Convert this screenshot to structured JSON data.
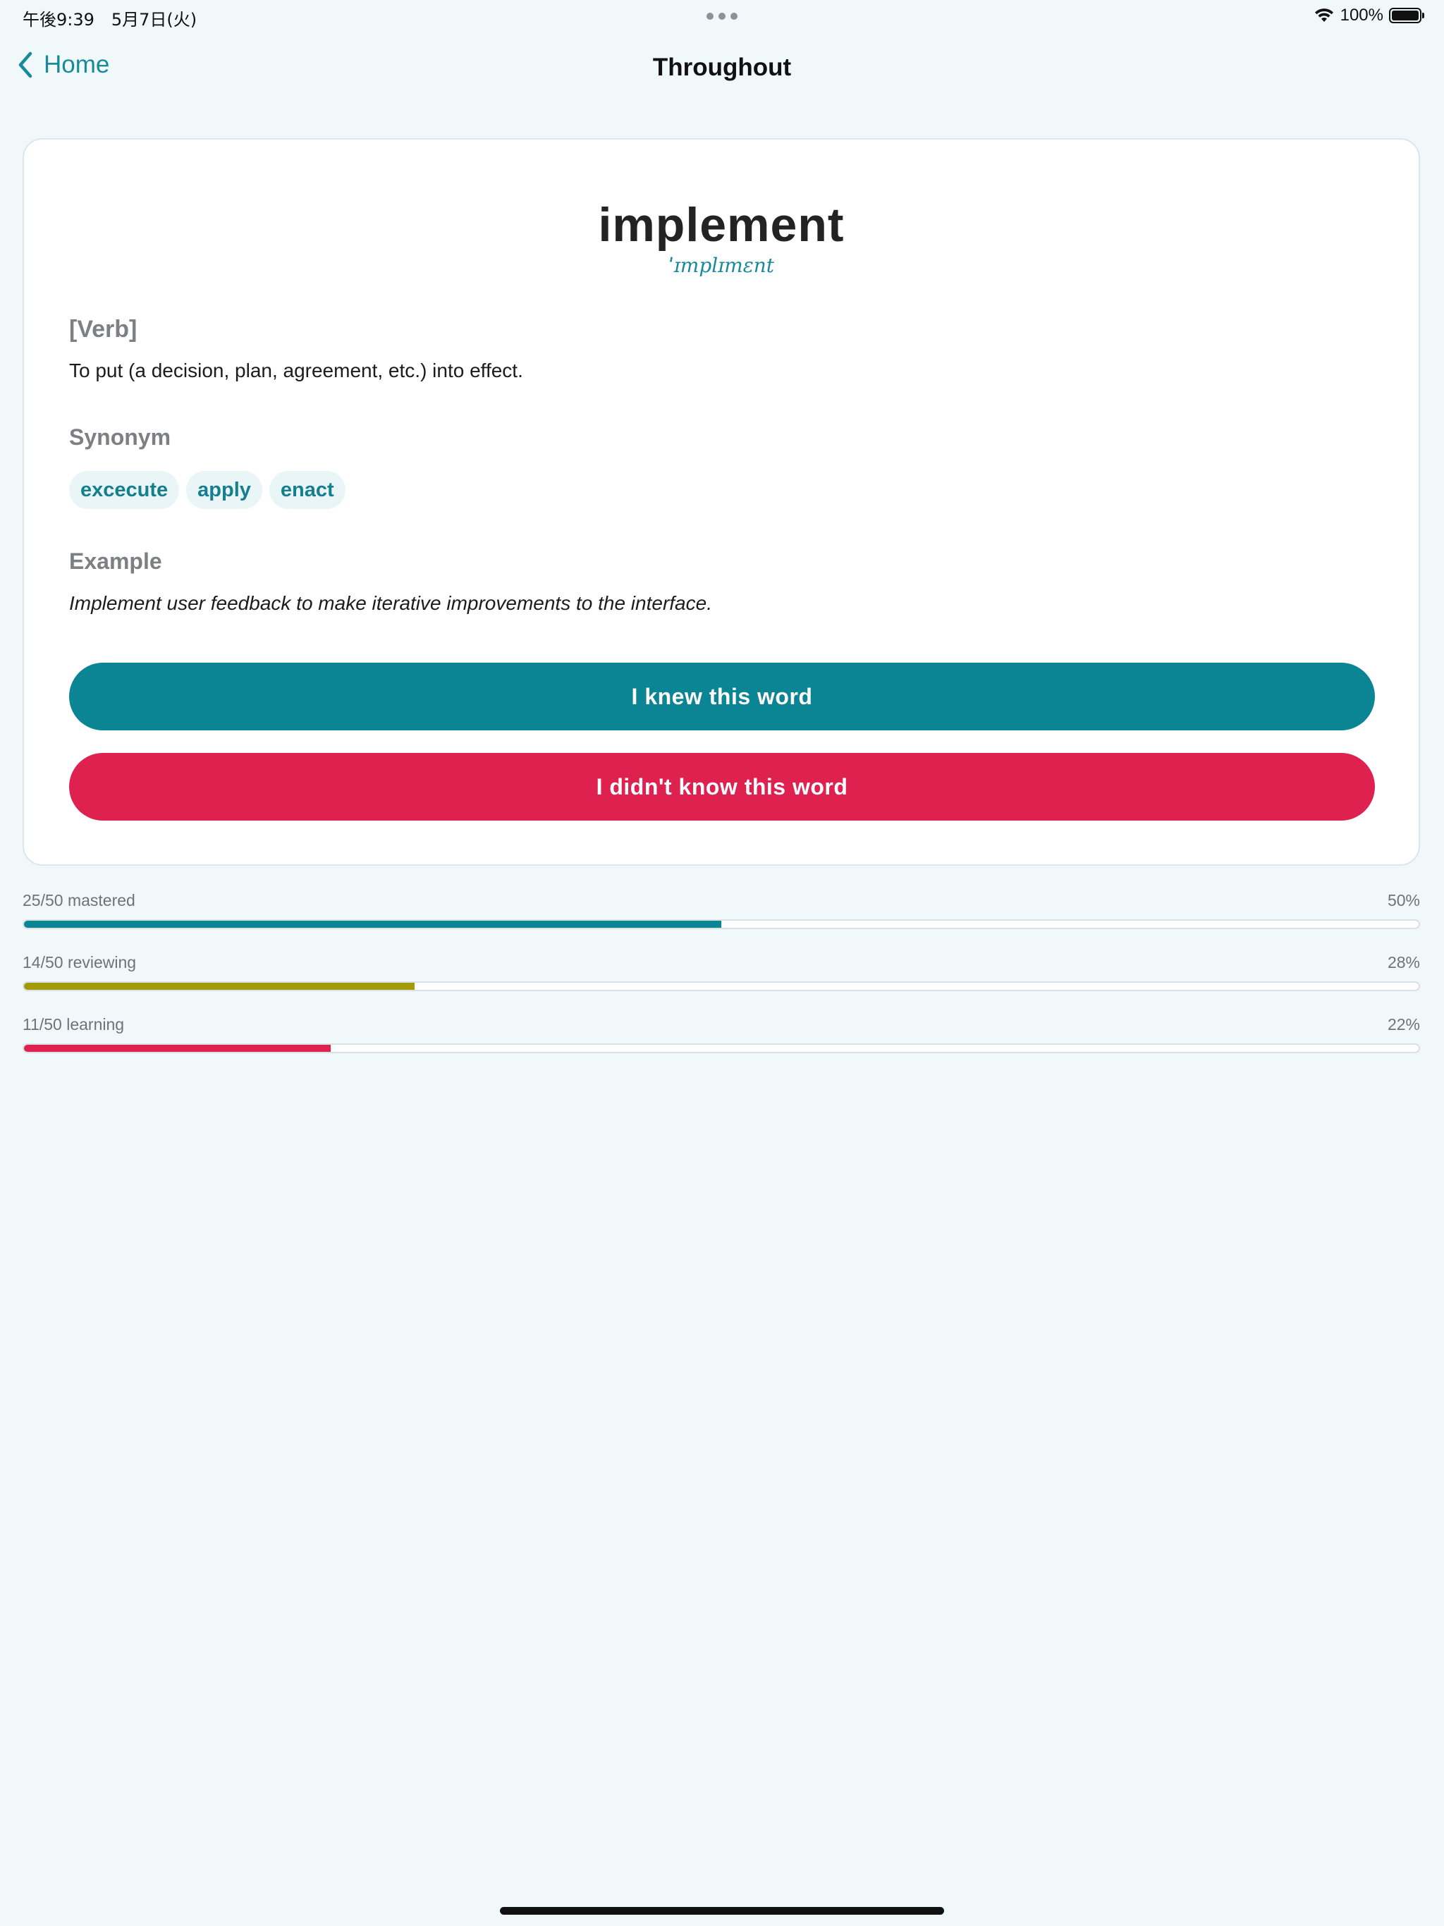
{
  "status_bar": {
    "time": "午後9:39　5月7日(火)",
    "battery": "100%",
    "wifi_icon": "wifi-icon",
    "battery_icon": "battery-icon"
  },
  "nav": {
    "back_label": "Home",
    "title": "Throughout"
  },
  "card": {
    "word": "implement",
    "pronunciation": "ˈɪmplɪmɛnt",
    "part_of_speech": "[Verb]",
    "definition": "To put (a decision, plan, agreement, etc.) into effect.",
    "synonym_heading": "Synonym",
    "synonyms": [
      "excecute",
      "apply",
      "enact"
    ],
    "example_heading": "Example",
    "example": "Implement user feedback to make iterative improvements to the interface.",
    "knew_button": "I knew this word",
    "didnt_button": "I didn't know this word"
  },
  "progress": [
    {
      "label": "25/50 mastered",
      "percent_text": "50%",
      "fraction": 0.5,
      "color": "#0b8493"
    },
    {
      "label": "14/50 reviewing",
      "percent_text": "28%",
      "fraction": 0.28,
      "color": "#a39a0a"
    },
    {
      "label": "11/50 learning",
      "percent_text": "22%",
      "fraction": 0.22,
      "color": "#df2150"
    }
  ],
  "colors": {
    "accent": "#188b9b",
    "knew_button": "#0b8493",
    "didnt_button": "#df2150",
    "background": "#f1f8fa"
  }
}
